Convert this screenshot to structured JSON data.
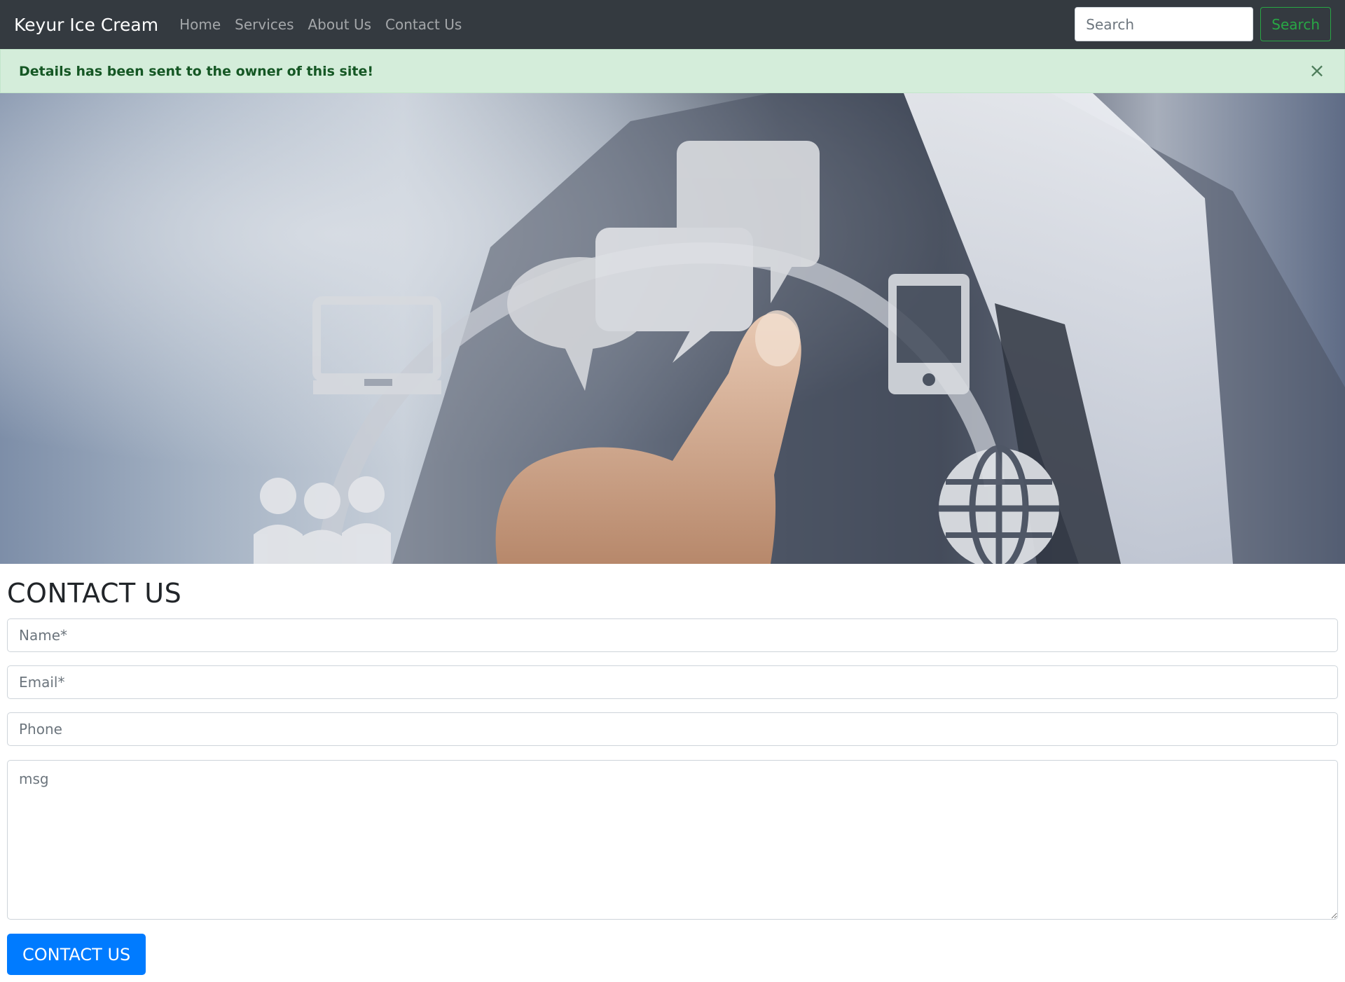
{
  "navbar": {
    "brand": "Keyur Ice Cream",
    "links": [
      "Home",
      "Services",
      "About Us",
      "Contact Us"
    ],
    "search_placeholder": "Search",
    "search_button": "Search"
  },
  "alert": {
    "message": "Details has been sent to the owner of this site!",
    "close_symbol": "×"
  },
  "hero": {
    "icons": [
      "chat-bubble-icon",
      "laptop-icon",
      "tablet-icon",
      "people-icon",
      "globe-icon"
    ]
  },
  "contact": {
    "title": "CONTACT US",
    "name_placeholder": "Name*",
    "email_placeholder": "Email*",
    "phone_placeholder": "Phone",
    "message_placeholder": "msg",
    "submit_label": "CONTACT US"
  },
  "colors": {
    "navbar_bg": "#343a40",
    "alert_bg": "#d4edda",
    "alert_text": "#155724",
    "primary": "#007bff",
    "success": "#28a745"
  }
}
